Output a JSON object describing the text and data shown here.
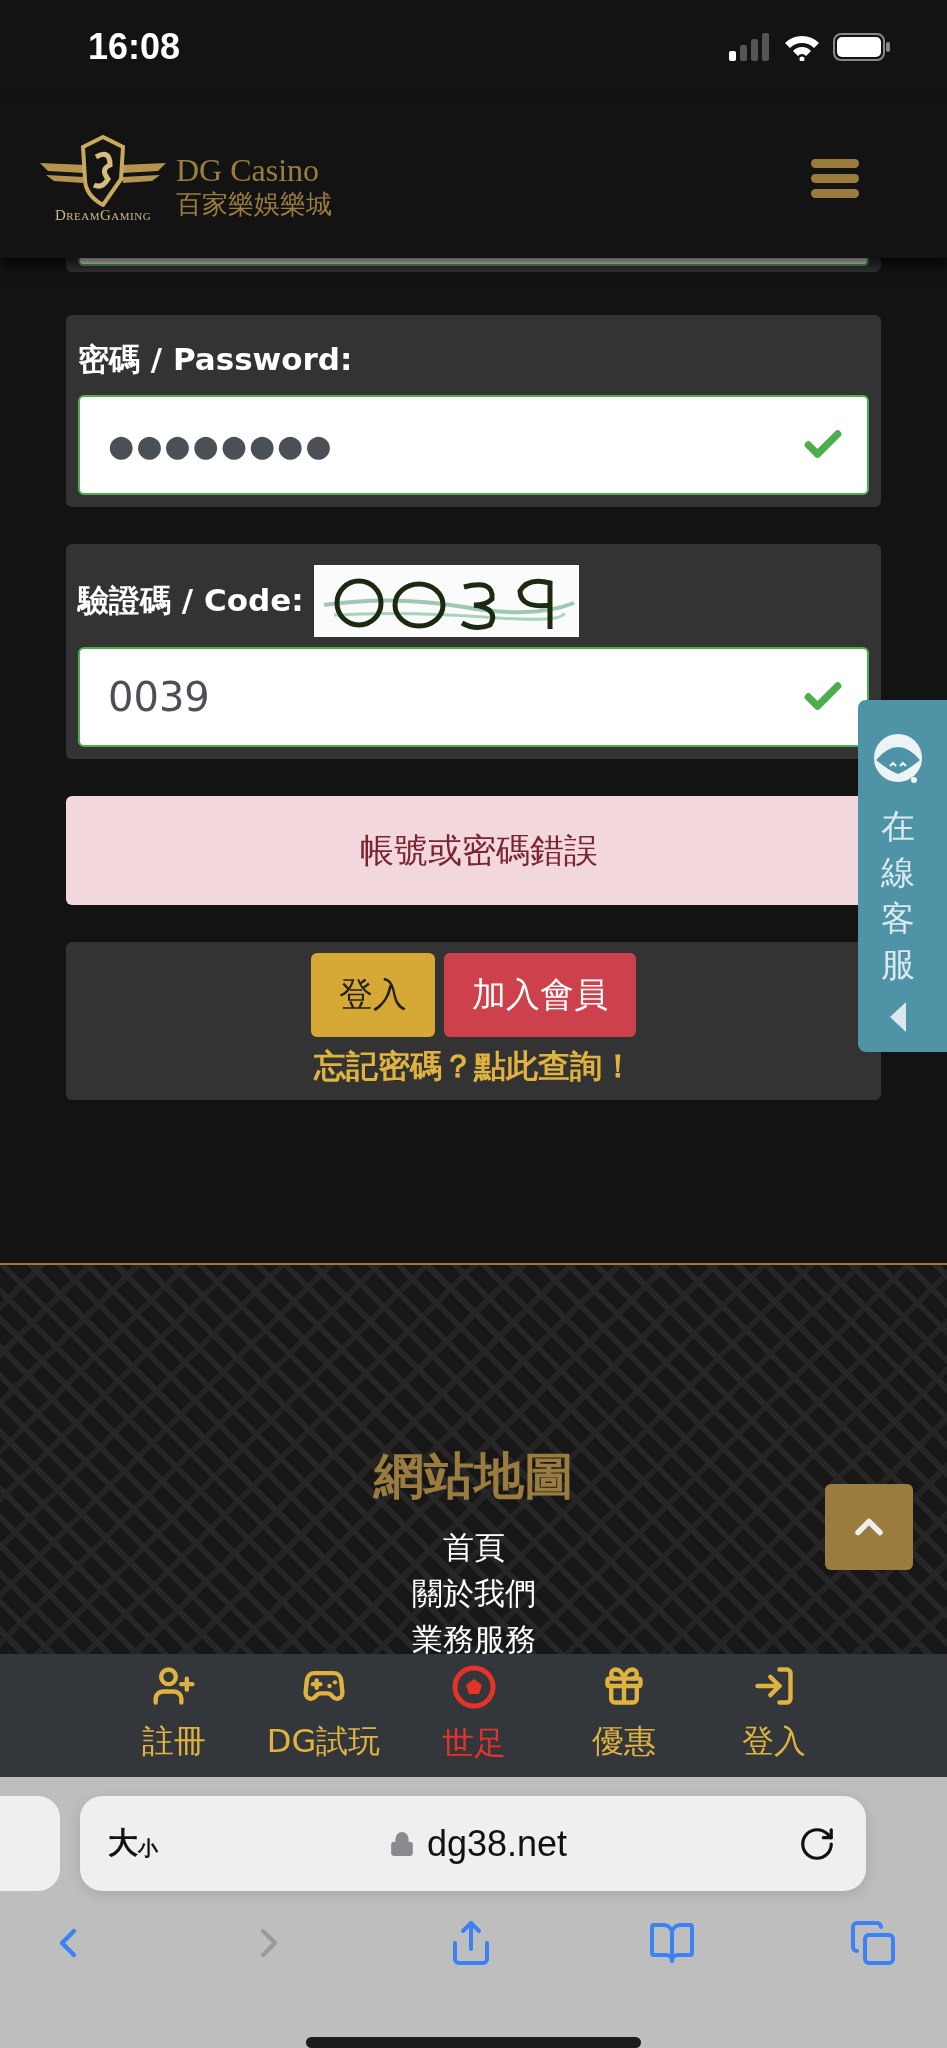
{
  "status_bar": {
    "time": "16:08"
  },
  "header": {
    "logo_caption": "DreamGaming",
    "brand_title": "DG Casino",
    "brand_subtitle": "百家樂娛樂城"
  },
  "form": {
    "fields": [
      {
        "kind": "password",
        "label": "密碼 / Password:",
        "value": "●●●●●●●●",
        "valid": true
      },
      {
        "kind": "captcha",
        "label": "驗證碼 / Code:",
        "value": "0039",
        "valid": true
      }
    ],
    "error": "帳號或密碼錯誤",
    "buttons": [
      {
        "kind": "primary",
        "label": "登入"
      },
      {
        "kind": "danger",
        "label": "加入會員"
      }
    ],
    "forgot_link": "忘記密碼？點此查詢！"
  },
  "side_tab": {
    "label": "在線客服"
  },
  "footer": {
    "title": "網站地圖",
    "links": [
      "首頁",
      "關於我們",
      "業務服務"
    ]
  },
  "bottom_nav": [
    {
      "kind": "register",
      "label": "註冊",
      "selected": false
    },
    {
      "kind": "games",
      "label": "DG試玩",
      "selected": false
    },
    {
      "kind": "football",
      "label": "世足",
      "selected": true
    },
    {
      "kind": "promo",
      "label": "優惠",
      "selected": false
    },
    {
      "kind": "login",
      "label": "登入",
      "selected": false
    }
  ],
  "browser": {
    "text_size": "大$_{小}$",
    "url": "dg38.net"
  }
}
